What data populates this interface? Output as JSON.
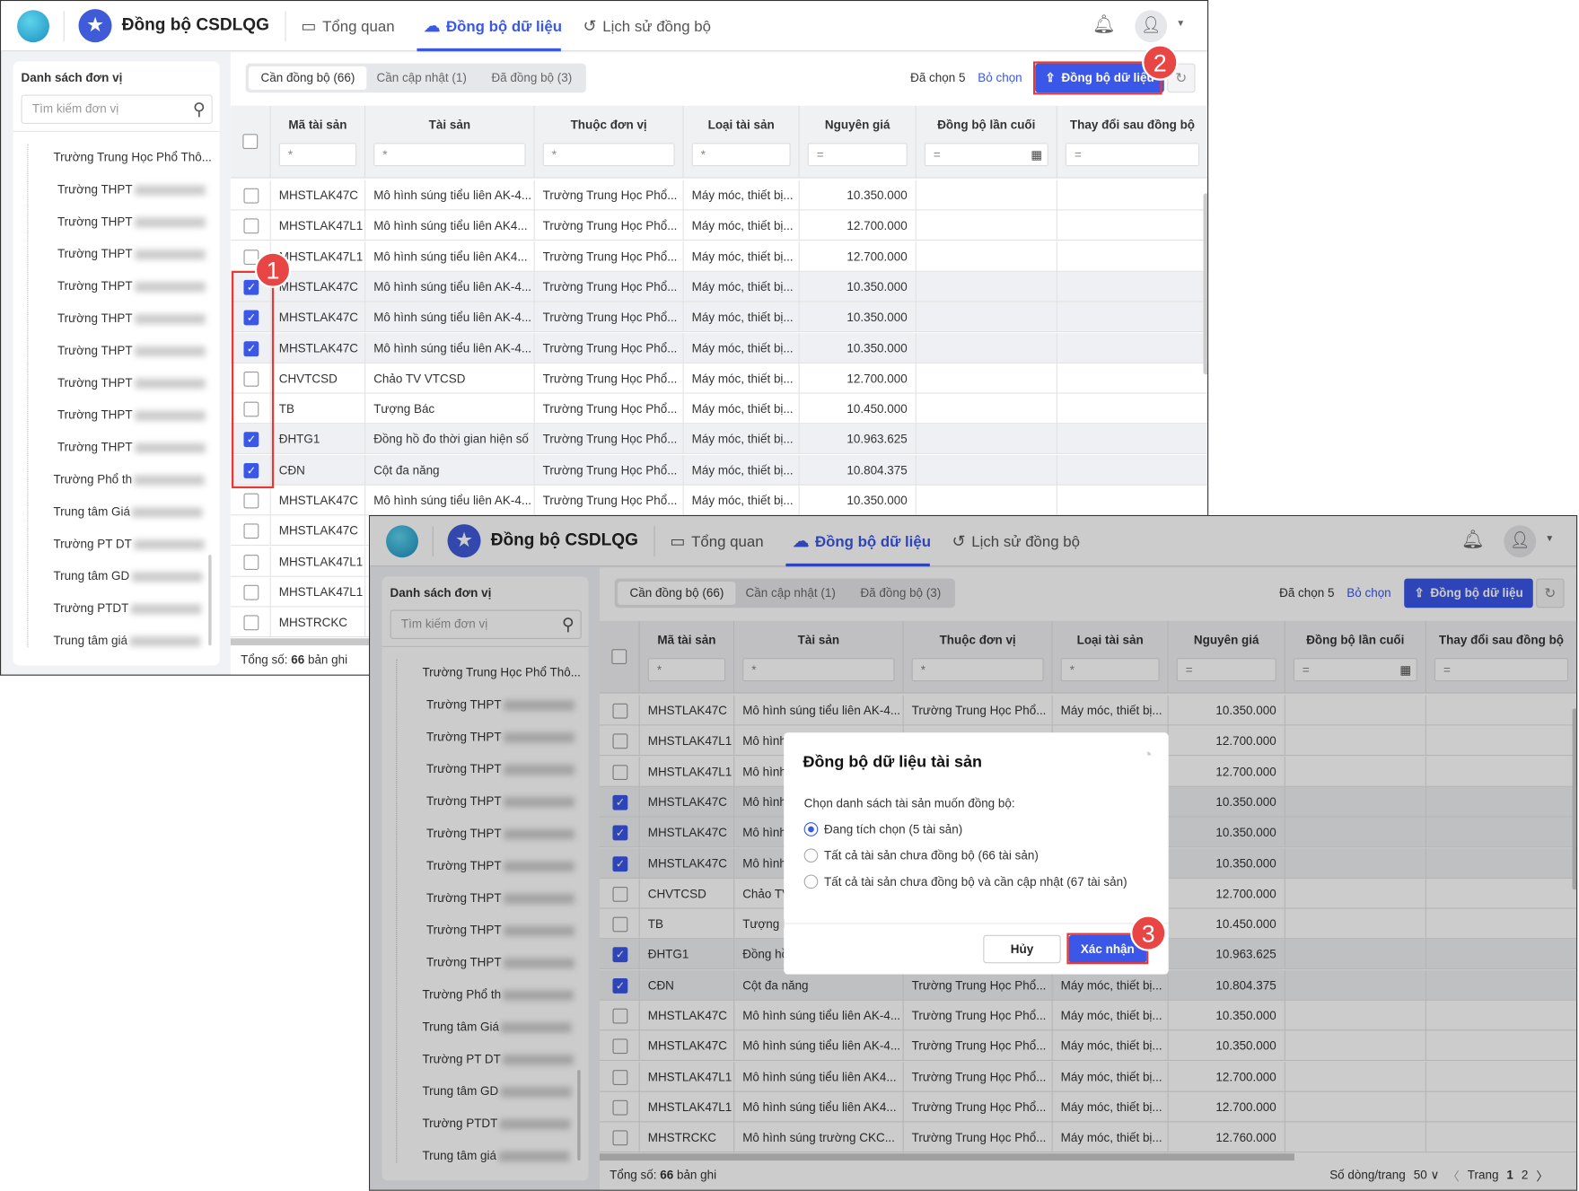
{
  "app": {
    "title": "Đồng bộ CSDLQG",
    "nav": [
      {
        "label": "Tổng quan",
        "icon": "monitor-icon"
      },
      {
        "label": "Đồng bộ dữ liệu",
        "icon": "cloud-check-icon"
      },
      {
        "label": "Lịch sử đồng bộ",
        "icon": "history-icon"
      }
    ]
  },
  "sidebar": {
    "title": "Danh sách đơn vị",
    "search_placeholder": "Tìm kiếm đơn vị",
    "items": [
      "Trường Trung Học Phổ Thô...",
      "Trường THPT",
      "Trường THPT",
      "Trường THPT",
      "Trường THPT",
      "Trường THPT",
      "Trường THPT",
      "Trường THPT",
      "Trường THPT",
      "Trường THPT",
      "Trường Phổ th",
      "Trung tâm Giá",
      "Trường PT DT",
      "Trung tâm GD",
      "Trường PTDT",
      "Trung tâm giá"
    ]
  },
  "tabs": [
    "Cần đồng bộ (66)",
    "Cần cập nhật (1)",
    "Đã đồng bộ (3)"
  ],
  "toolbar": {
    "selected": "Đã chọn 5",
    "deselect": "Bỏ chọn",
    "sync": "Đồng bộ dữ liệu"
  },
  "table": {
    "columns": [
      "Mã tài sản",
      "Tài sản",
      "Thuộc đơn vị",
      "Loại tài sản",
      "Nguyên giá",
      "Đồng bộ lần cuối",
      "Thay đổi sau đồng bộ"
    ],
    "filters": [
      "*",
      "*",
      "*",
      "*",
      "=",
      "=",
      "="
    ],
    "rows": [
      {
        "checked": false,
        "code": "MHSTLAK47C",
        "name": "Mô hình súng tiểu liên AK-4...",
        "unit": "Trường Trung Học Phổ...",
        "type": "Máy móc, thiết bị...",
        "price": "10.350.000"
      },
      {
        "checked": false,
        "code": "MHSTLAK47L1",
        "name": "Mô hình súng tiểu liên AK4...",
        "unit": "Trường Trung Học Phổ...",
        "type": "Máy móc, thiết bị...",
        "price": "12.700.000"
      },
      {
        "checked": false,
        "code": "MHSTLAK47L1",
        "name": "Mô hình súng tiểu liên AK4...",
        "unit": "Trường Trung Học Phổ...",
        "type": "Máy móc, thiết bị...",
        "price": "12.700.000"
      },
      {
        "checked": true,
        "code": "MHSTLAK47C",
        "name": "Mô hình súng tiểu liên AK-4...",
        "unit": "Trường Trung Học Phổ...",
        "type": "Máy móc, thiết bị...",
        "price": "10.350.000"
      },
      {
        "checked": true,
        "code": "MHSTLAK47C",
        "name": "Mô hình súng tiểu liên AK-4...",
        "unit": "Trường Trung Học Phổ...",
        "type": "Máy móc, thiết bị...",
        "price": "10.350.000"
      },
      {
        "checked": true,
        "code": "MHSTLAK47C",
        "name": "Mô hình súng tiểu liên AK-4...",
        "unit": "Trường Trung Học Phổ...",
        "type": "Máy móc, thiết bị...",
        "price": "10.350.000"
      },
      {
        "checked": false,
        "code": "CHVTCSD",
        "name": "Chảo TV VTCSD",
        "unit": "Trường Trung Học Phổ...",
        "type": "Máy móc, thiết bị...",
        "price": "12.700.000"
      },
      {
        "checked": false,
        "code": "TB",
        "name": "Tượng Bác",
        "unit": "Trường Trung Học Phổ...",
        "type": "Máy móc, thiết bị...",
        "price": "10.450.000"
      },
      {
        "checked": true,
        "code": "ĐHTG1",
        "name": "Đồng hồ đo thời gian hiện số",
        "unit": "Trường Trung Học Phổ...",
        "type": "Máy móc, thiết bị...",
        "price": "10.963.625"
      },
      {
        "checked": true,
        "code": "CĐN",
        "name": "Cột đa năng",
        "unit": "Trường Trung Học Phổ...",
        "type": "Máy móc, thiết bị...",
        "price": "10.804.375"
      },
      {
        "checked": false,
        "code": "MHSTLAK47C",
        "name": "Mô hình súng tiểu liên AK-4...",
        "unit": "Trường Trung Học Phổ...",
        "type": "Máy móc, thiết bị...",
        "price": "10.350.000"
      },
      {
        "checked": false,
        "code": "MHSTLAK47C",
        "name": "Mô hình súng tiểu liên AK-4...",
        "unit": "Trường Trung Học Phổ...",
        "type": "Máy móc, thiết bị...",
        "price": "10.350.000"
      },
      {
        "checked": false,
        "code": "MHSTLAK47L1",
        "name": "Mô hình súng tiểu liên AK4...",
        "unit": "Trường Trung Học Phổ...",
        "type": "Máy móc, thiết bị...",
        "price": "12.700.000"
      },
      {
        "checked": false,
        "code": "MHSTLAK47L1",
        "name": "Mô hình súng tiểu liên AK4...",
        "unit": "Trường Trung Học Phổ...",
        "type": "Máy móc, thiết bị...",
        "price": "12.700.000"
      },
      {
        "checked": false,
        "code": "MHSTRCKC",
        "name": "Mô hình súng trường CKC...",
        "unit": "Trường Trung Học Phổ...",
        "type": "Máy móc, thiết bị...",
        "price": "12.760.000"
      }
    ]
  },
  "footer": {
    "total_label": "Tổng số:",
    "total": "66",
    "total_suffix": "bản ghi",
    "page_size_label": "Số dòng/trang",
    "page_size": "50",
    "page_label": "Trang",
    "pages": [
      "1",
      "2"
    ]
  },
  "modal": {
    "title": "Đồng bộ dữ liệu tài sản",
    "prompt": "Chọn danh sách tài sản muốn đồng bộ:",
    "options": [
      {
        "label": "Đang tích chọn (5 tài sản)",
        "selected": true
      },
      {
        "label": "Tất cả tài sản chưa đồng bộ (66 tài sản)",
        "selected": false
      },
      {
        "label": "Tất cả tài sản chưa đồng bộ và cần cập nhật (67 tài sản)",
        "selected": false
      }
    ],
    "cancel": "Hủy",
    "confirm": "Xác nhận"
  },
  "annotations": [
    "1",
    "2",
    "3"
  ],
  "colors": {
    "accent": "#3a57e8",
    "annotation": "#e84545"
  }
}
